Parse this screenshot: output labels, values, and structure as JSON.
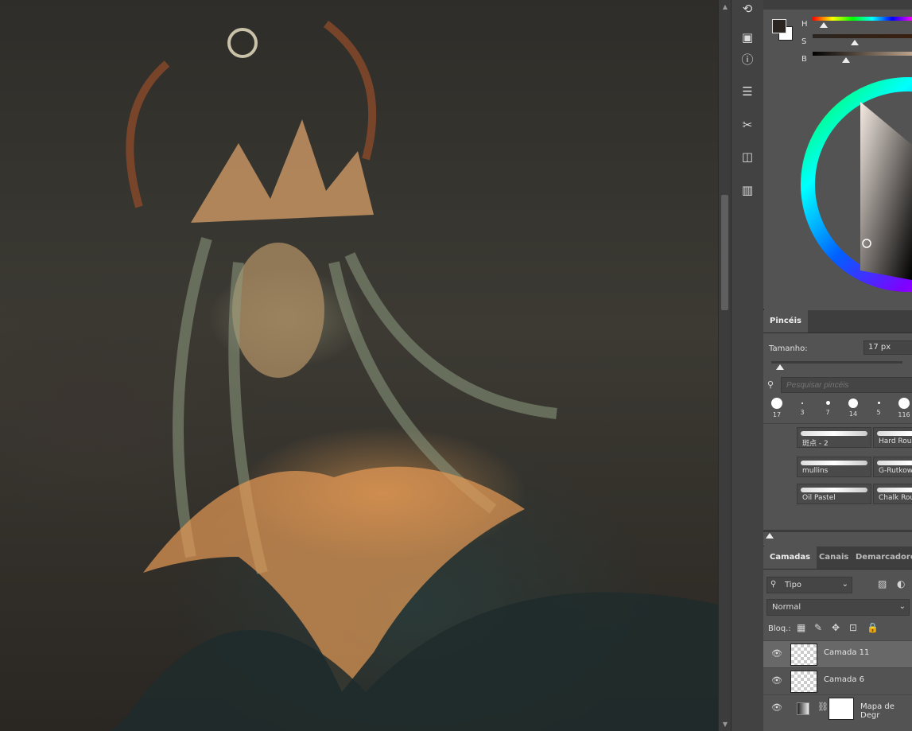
{
  "colors": {
    "foreground": "#2a2520",
    "background": "#ffffff"
  },
  "color_panel": {
    "sliders": [
      {
        "label": "H",
        "value": 0.1
      },
      {
        "label": "S",
        "value": 0.42
      },
      {
        "label": "B",
        "value": 0.34
      }
    ]
  },
  "brushes": {
    "tab": "Pincéis",
    "size_label": "Tamanho:",
    "size_value": "17 px",
    "size_slider": 0.08,
    "search_placeholder": "Pesquisar pincéis",
    "tips": [
      "17",
      "3",
      "7",
      "14",
      "5",
      "116"
    ],
    "presets": [
      {
        "name": "斑点 - 2"
      },
      {
        "name": "Hard Rou"
      },
      {
        "name": "mullins"
      },
      {
        "name": "G-Rutkow"
      },
      {
        "name": "Oil Pastel"
      },
      {
        "name": "Chalk Rou"
      }
    ]
  },
  "layers": {
    "tabs": [
      "Camadas",
      "Canais",
      "Demarcadores"
    ],
    "filter_kind": "Tipo",
    "blend_mode": "Normal",
    "lock_label": "Bloq.:",
    "items": [
      {
        "name": "Camada 11",
        "selected": true
      },
      {
        "name": "Camada 6",
        "selected": false
      },
      {
        "name": "Mapa de Degr",
        "selected": false
      }
    ]
  },
  "tools": [
    "history-icon",
    "library-icon",
    "info-icon",
    "properties-icon",
    "tools-icon",
    "swatches-icon",
    "gradient-icon"
  ]
}
